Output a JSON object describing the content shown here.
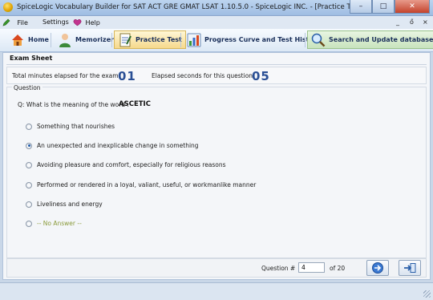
{
  "window": {
    "title": "SpiceLogic Vocabulary Builder for SAT ACT GRE GMAT LSAT 1.10.5.0 - SpiceLogic INC. - [Practice Test]",
    "controls": {
      "minimize": "–",
      "maximize": "□",
      "close": "✕"
    }
  },
  "menubar": {
    "items": [
      {
        "label": "File",
        "icon": "pencil-icon"
      },
      {
        "label": "Settings"
      },
      {
        "label": "Help",
        "icon": "help-icon"
      }
    ],
    "mdi_controls": {
      "minimize": "_",
      "restore": "ő",
      "close": "×"
    }
  },
  "toolbar": {
    "buttons": [
      {
        "label": "Home",
        "icon": "home-icon"
      },
      {
        "label": "Memorizer",
        "icon": "person-icon"
      },
      {
        "label": "Practice Test",
        "icon": "test-icon",
        "active": true
      },
      {
        "label": "Progress Curve and Test History",
        "icon": "chart-icon"
      },
      {
        "label": "Search and Update database",
        "icon": "search-icon"
      }
    ]
  },
  "exam": {
    "section_title": "Exam Sheet",
    "minutes_label": "Total minutes elapsed for the exam:",
    "minutes_value": "01",
    "seconds_label": "Elapsed seconds for this question:",
    "seconds_value": "05"
  },
  "question": {
    "group_title": "Question",
    "prompt": "Q: What is the meaning of the word :",
    "word": "ASCETIC",
    "options": [
      {
        "label": "Something that nourishes",
        "selected": false
      },
      {
        "label": "An unexpected and inexplicable change in something",
        "selected": true
      },
      {
        "label": "Avoiding pleasure and comfort, especially for religious reasons",
        "selected": false
      },
      {
        "label": "Performed or rendered in a loyal, valiant, useful, or workmanlike manner",
        "selected": false
      },
      {
        "label": "Liveliness and energy",
        "selected": false
      },
      {
        "label": "-- No Answer --",
        "selected": false
      }
    ]
  },
  "navigation": {
    "question_label": "Question #",
    "question_number": "4",
    "of_label": "of 20",
    "buttons": [
      {
        "name": "next-question-button",
        "icon": "arrow-right-icon"
      },
      {
        "name": "finish-test-button",
        "icon": "arrow-into-box-icon"
      }
    ]
  },
  "colors": {
    "accent_blue": "#2a4f95",
    "active_tab": "#f6d98c",
    "no_answer_text": "#8a9a3a",
    "window_frame": "#bcd4ef"
  }
}
